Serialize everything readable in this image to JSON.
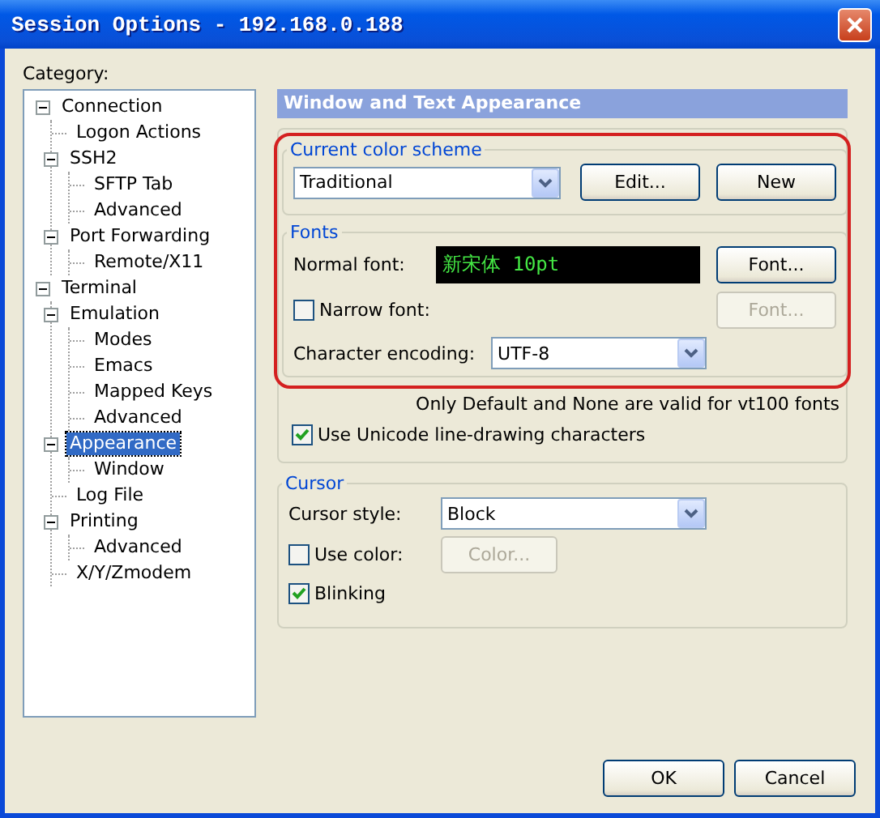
{
  "window": {
    "title": "Session Options - 192.168.0.188"
  },
  "category_label": "Category:",
  "tree": [
    {
      "label": "Connection",
      "expanded": true,
      "selected": false,
      "children": [
        {
          "label": "Logon Actions",
          "selected": false
        },
        {
          "label": "SSH2",
          "expanded": true,
          "selected": false,
          "children": [
            {
              "label": "SFTP Tab",
              "selected": false
            },
            {
              "label": "Advanced",
              "selected": false
            }
          ]
        },
        {
          "label": "Port Forwarding",
          "expanded": true,
          "selected": false,
          "children": [
            {
              "label": "Remote/X11",
              "selected": false
            }
          ]
        }
      ]
    },
    {
      "label": "Terminal",
      "expanded": true,
      "selected": false,
      "children": [
        {
          "label": "Emulation",
          "expanded": true,
          "selected": false,
          "children": [
            {
              "label": "Modes",
              "selected": false
            },
            {
              "label": "Emacs",
              "selected": false
            },
            {
              "label": "Mapped Keys",
              "selected": false
            },
            {
              "label": "Advanced",
              "selected": false
            }
          ]
        },
        {
          "label": "Appearance",
          "expanded": true,
          "selected": true,
          "children": [
            {
              "label": "Window",
              "selected": false
            }
          ]
        },
        {
          "label": "Log File",
          "selected": false
        },
        {
          "label": "Printing",
          "expanded": true,
          "selected": false,
          "children": [
            {
              "label": "Advanced",
              "selected": false
            }
          ]
        },
        {
          "label": "X/Y/Zmodem",
          "selected": false
        }
      ]
    }
  ],
  "panel": {
    "header": "Window and Text Appearance",
    "color_scheme": {
      "legend": "Current color scheme",
      "value": "Traditional",
      "buttons": [
        {
          "label": "Edit...",
          "disabled": false
        },
        {
          "label": "New",
          "disabled": false
        }
      ]
    },
    "fonts": {
      "legend": "Fonts",
      "normal_label": "Normal font:",
      "preview": "新宋体 10pt",
      "normal_button": {
        "label": "Font...",
        "disabled": false
      },
      "narrow": {
        "label": "Narrow font:",
        "checked": false
      },
      "narrow_button": {
        "label": "Font...",
        "disabled": true
      },
      "encoding_label": "Character encoding:",
      "encoding": "UTF-8"
    },
    "hint": "Only Default and None are valid for vt100 fonts",
    "unicode": {
      "label": "Use Unicode line-drawing characters",
      "checked": true
    },
    "cursor": {
      "legend": "Cursor",
      "style_label": "Cursor style:",
      "style": "Block",
      "use_color": {
        "label": "Use color:",
        "checked": false
      },
      "color_button": {
        "label": "Color...",
        "disabled": true
      },
      "blinking": {
        "label": "Blinking",
        "checked": true
      }
    }
  },
  "buttons": [
    {
      "label": "OK"
    },
    {
      "label": "Cancel"
    }
  ]
}
